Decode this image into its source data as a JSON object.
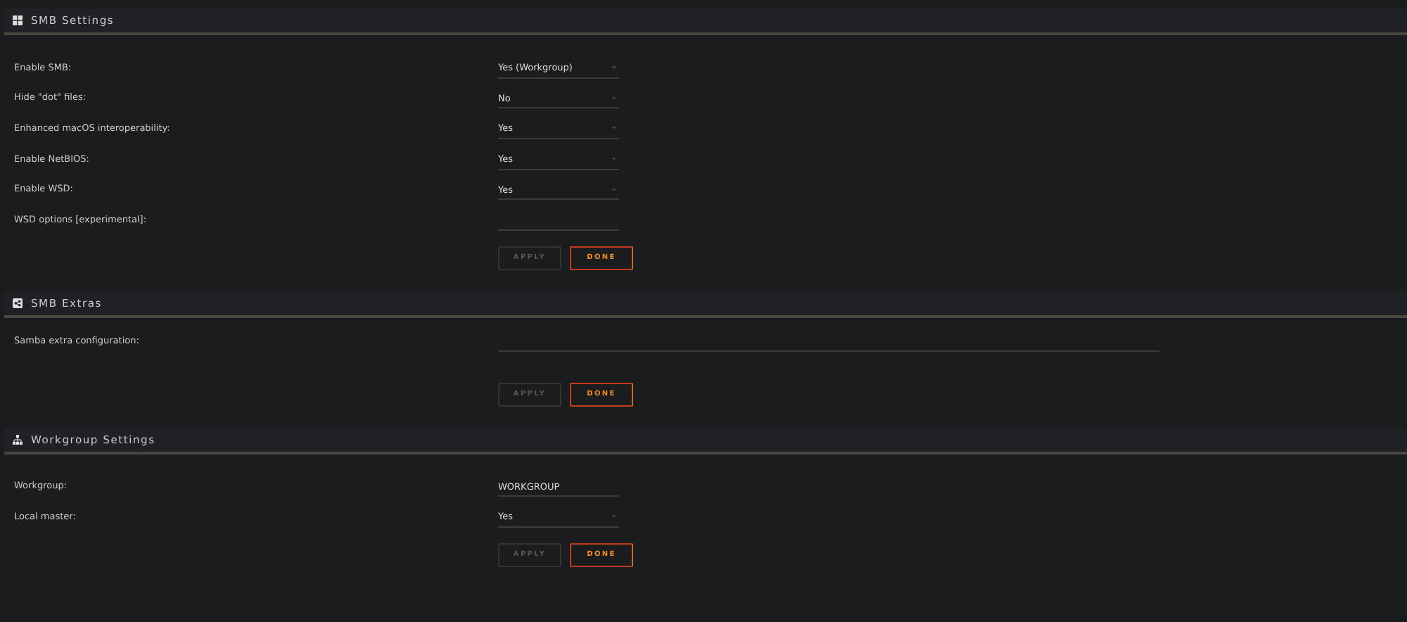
{
  "sections": [
    {
      "title": "SMB Settings",
      "fields": [
        {
          "label": "Enable SMB:",
          "kind": "select",
          "value": "Yes (Workgroup)"
        },
        {
          "label": "Hide \"dot\" files:",
          "kind": "select",
          "value": "No"
        },
        {
          "label": "Enhanced macOS interoperability:",
          "kind": "select",
          "value": "Yes"
        },
        {
          "label": "Enable NetBIOS:",
          "kind": "select",
          "value": "Yes"
        },
        {
          "label": "Enable WSD:",
          "kind": "select",
          "value": "Yes"
        },
        {
          "label": "WSD options [experimental]:",
          "kind": "text"
        }
      ],
      "buttons": [
        {
          "label": "APPLY",
          "disabled": true
        },
        {
          "label": "DONE",
          "disabled": false
        }
      ]
    },
    {
      "title": "SMB Extras",
      "fields": [
        {
          "label": "Samba extra configuration:",
          "kind": "textarea"
        }
      ],
      "buttons": [
        {
          "label": "APPLY",
          "disabled": true
        },
        {
          "label": "DONE",
          "disabled": false
        }
      ]
    },
    {
      "title": "Workgroup Settings",
      "fields": [
        {
          "label": "Workgroup:",
          "kind": "text",
          "value": "WORKGROUP"
        },
        {
          "label": "Local master:",
          "kind": "select",
          "value": "Yes"
        }
      ],
      "buttons": [
        {
          "label": "APPLY",
          "disabled": true
        },
        {
          "label": "DONE",
          "disabled": false
        }
      ]
    }
  ]
}
